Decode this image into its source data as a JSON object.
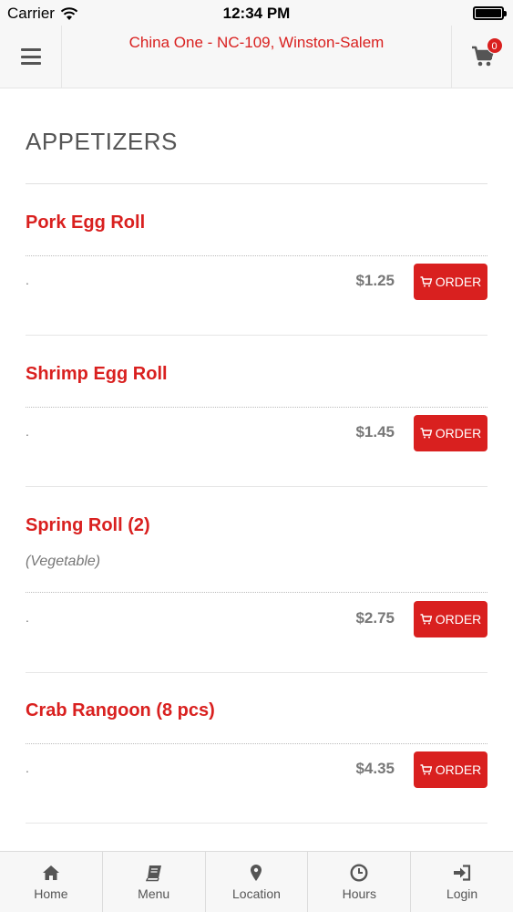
{
  "status_bar": {
    "carrier": "Carrier",
    "time": "12:34 PM"
  },
  "header": {
    "title": "China One - NC-109, Winston-Salem",
    "cart_count": "0"
  },
  "section": {
    "title": "APPETIZERS"
  },
  "items": [
    {
      "name": "Pork Egg Roll",
      "description": "",
      "dot": ".",
      "price": "$1.25",
      "button": "ORDER"
    },
    {
      "name": "Shrimp Egg Roll",
      "description": "",
      "dot": ".",
      "price": "$1.45",
      "button": "ORDER"
    },
    {
      "name": "Spring Roll (2)",
      "description": "(Vegetable)",
      "dot": ".",
      "price": "$2.75",
      "button": "ORDER"
    },
    {
      "name": "Crab Rangoon (8 pcs)",
      "description": "",
      "dot": ".",
      "price": "$4.35",
      "button": "ORDER"
    }
  ],
  "bottom_nav": [
    {
      "label": "Home",
      "icon": "home-icon"
    },
    {
      "label": "Menu",
      "icon": "book-icon"
    },
    {
      "label": "Location",
      "icon": "map-pin-icon"
    },
    {
      "label": "Hours",
      "icon": "clock-icon"
    },
    {
      "label": "Login",
      "icon": "login-icon"
    }
  ],
  "colors": {
    "accent": "#d9201f",
    "text": "#555555",
    "muted": "#777777",
    "bar": "#f7f7f7"
  }
}
